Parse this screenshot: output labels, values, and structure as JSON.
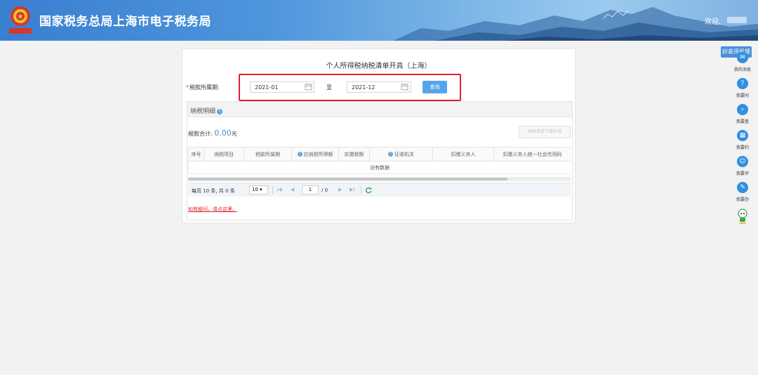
{
  "header": {
    "site_title": "国家税务总局上海市电子税务局",
    "welcome": "欢迎,"
  },
  "panel": {
    "title": "个人所得税纳税清单开具（上海）",
    "period_label": "税款所属期:",
    "required_mark": "*",
    "date_from": "2021-01",
    "to_label": "至",
    "date_to": "2021-12",
    "query_button": "查询",
    "highlight_color": "#e3202b"
  },
  "detail": {
    "title": "纳税明细",
    "sum_label": "税款合计:",
    "sum_value": "0.00",
    "sum_unit": "元",
    "print_button": "纳税清单下载申请",
    "columns": [
      "序号",
      "纳税项目",
      "税款所属期",
      "应纳税所得额",
      "实缴税额",
      "征收机关",
      "扣缴义务人",
      "扣缴义务人统一社会信用码"
    ],
    "empty_text": "没有数据",
    "pager": {
      "info": "每页 10 条, 共 0 条",
      "page_size": "10",
      "current_page": "1",
      "total_pages": "/ 0"
    },
    "notice": "如有疑问，请点这里。"
  },
  "sidebar": {
    "feedback": "好差评反馈",
    "items": [
      {
        "label": "我的消息",
        "icon": "message-icon"
      },
      {
        "label": "我要问",
        "icon": "question-icon"
      },
      {
        "label": "我要查",
        "icon": "search-icon"
      },
      {
        "label": "我要约",
        "icon": "calendar-icon"
      },
      {
        "label": "我要评",
        "icon": "rate-icon"
      },
      {
        "label": "我要办",
        "icon": "edit-icon"
      }
    ]
  },
  "colors": {
    "header_blue": "#3a7fd0",
    "accent_blue": "#56a5ea",
    "value_blue": "#3c8fd8",
    "alert_red": "#e3202b"
  }
}
